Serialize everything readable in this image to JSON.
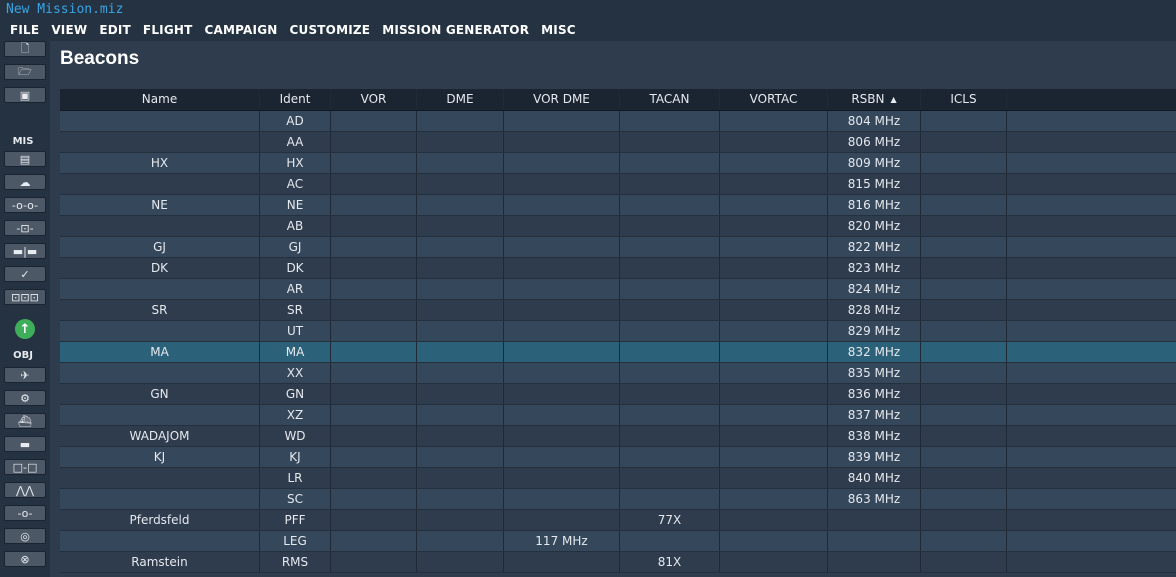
{
  "window": {
    "title": "New Mission.miz"
  },
  "menu": [
    "FILE",
    "VIEW",
    "EDIT",
    "FLIGHT",
    "CAMPAIGN",
    "CUSTOMIZE",
    "MISSION GENERATOR",
    "MISC"
  ],
  "toolbar": {
    "mis_label": "MIS",
    "obj_label": "OBJ"
  },
  "page": {
    "title": "Beacons"
  },
  "table": {
    "columns": [
      "Name",
      "Ident",
      "VOR",
      "DME",
      "VOR DME",
      "TACAN",
      "VORTAC",
      "RSBN",
      "ICLS",
      ""
    ],
    "sort_indicator": "▲",
    "rows": [
      [
        "",
        "AD",
        "",
        "",
        "",
        "",
        "",
        "804 MHz",
        ""
      ],
      [
        "",
        "AA",
        "",
        "",
        "",
        "",
        "",
        "806 MHz",
        ""
      ],
      [
        "HX",
        "HX",
        "",
        "",
        "",
        "",
        "",
        "809 MHz",
        ""
      ],
      [
        "",
        "AC",
        "",
        "",
        "",
        "",
        "",
        "815 MHz",
        ""
      ],
      [
        "NE",
        "NE",
        "",
        "",
        "",
        "",
        "",
        "816 MHz",
        ""
      ],
      [
        "",
        "AB",
        "",
        "",
        "",
        "",
        "",
        "820 MHz",
        ""
      ],
      [
        "GJ",
        "GJ",
        "",
        "",
        "",
        "",
        "",
        "822 MHz",
        ""
      ],
      [
        "DK",
        "DK",
        "",
        "",
        "",
        "",
        "",
        "823 MHz",
        ""
      ],
      [
        "",
        "AR",
        "",
        "",
        "",
        "",
        "",
        "824 MHz",
        ""
      ],
      [
        "SR",
        "SR",
        "",
        "",
        "",
        "",
        "",
        "828 MHz",
        ""
      ],
      [
        "",
        "UT",
        "",
        "",
        "",
        "",
        "",
        "829 MHz",
        ""
      ],
      [
        "MA",
        "MA",
        "",
        "",
        "",
        "",
        "",
        "832 MHz",
        ""
      ],
      [
        "",
        "XX",
        "",
        "",
        "",
        "",
        "",
        "835 MHz",
        ""
      ],
      [
        "GN",
        "GN",
        "",
        "",
        "",
        "",
        "",
        "836 MHz",
        ""
      ],
      [
        "",
        "XZ",
        "",
        "",
        "",
        "",
        "",
        "837 MHz",
        ""
      ],
      [
        "WADAJOM",
        "WD",
        "",
        "",
        "",
        "",
        "",
        "838 MHz",
        ""
      ],
      [
        "KJ",
        "KJ",
        "",
        "",
        "",
        "",
        "",
        "839 MHz",
        ""
      ],
      [
        "",
        "LR",
        "",
        "",
        "",
        "",
        "",
        "840 MHz",
        ""
      ],
      [
        "",
        "SC",
        "",
        "",
        "",
        "",
        "",
        "863 MHz",
        ""
      ],
      [
        "Pferdsfeld",
        "PFF",
        "",
        "",
        "",
        "77X",
        "",
        "",
        ""
      ],
      [
        "",
        "LEG",
        "",
        "",
        "117 MHz",
        "",
        "",
        "",
        ""
      ],
      [
        "Ramstein",
        "RMS",
        "",
        "",
        "",
        "81X",
        "",
        "",
        ""
      ]
    ],
    "selected_row": 11
  },
  "colors": {
    "accent": "#39a4e3",
    "selection": "#2b6279",
    "go_button": "#3fae5a"
  }
}
